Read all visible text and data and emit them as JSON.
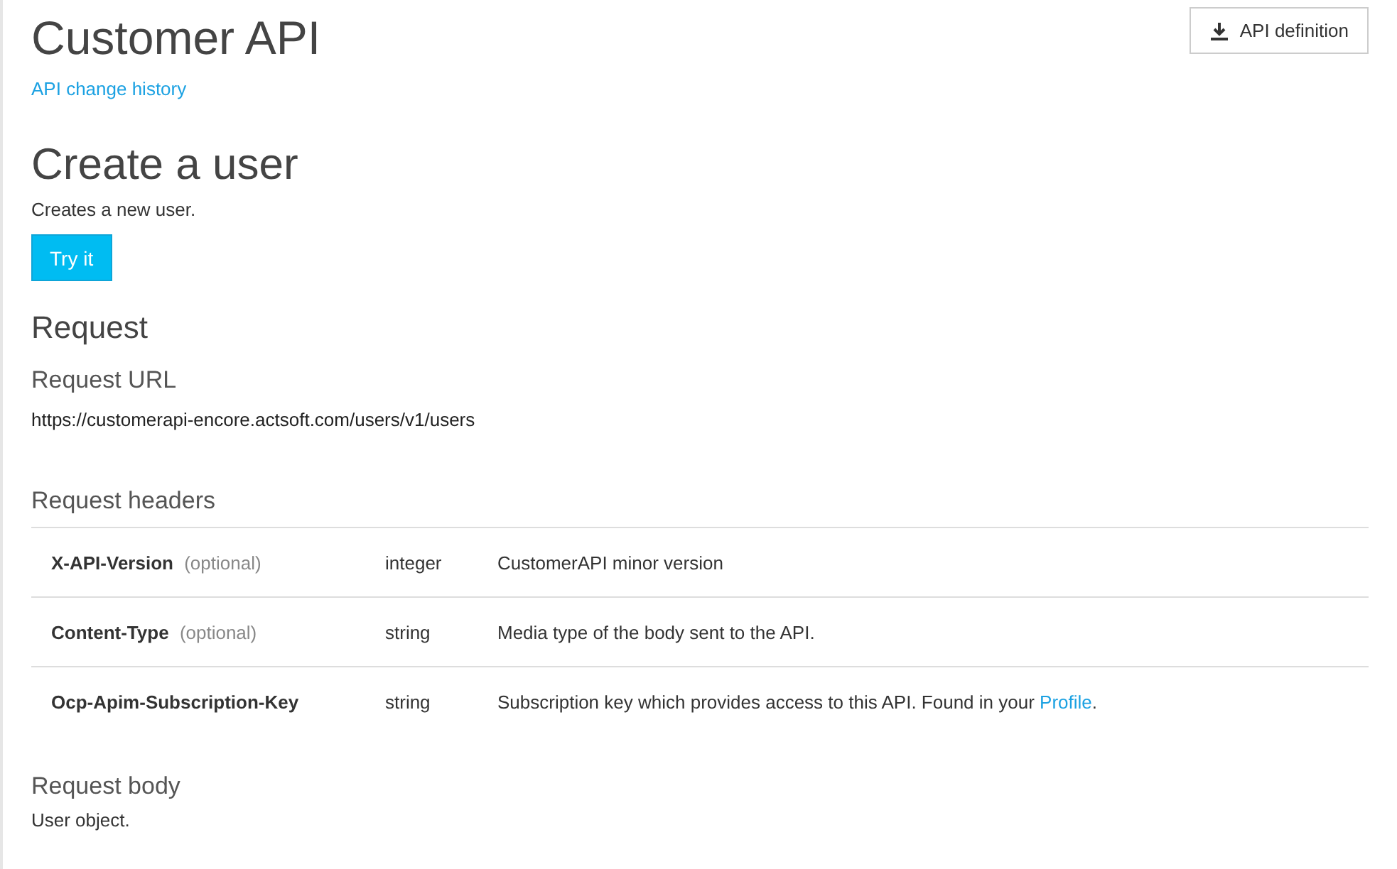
{
  "api_title": "Customer API",
  "definition_button": "API definition",
  "change_history_link": "API change history",
  "operation": {
    "title": "Create a user",
    "description": "Creates a new user.",
    "try_button": "Try it"
  },
  "request": {
    "heading": "Request",
    "url_heading": "Request URL",
    "url": "https://customerapi-encore.actsoft.com/users/v1/users",
    "headers_heading": "Request headers",
    "headers": [
      {
        "name": "X-API-Version",
        "optional_label": "(optional)",
        "type": "integer",
        "description": "CustomerAPI minor version"
      },
      {
        "name": "Content-Type",
        "optional_label": "(optional)",
        "type": "string",
        "description": "Media type of the body sent to the API."
      },
      {
        "name": "Ocp-Apim-Subscription-Key",
        "type": "string",
        "description": "Subscription key which provides access to this API. Found in your ",
        "link": "Profile",
        "description_end": "."
      }
    ],
    "body_heading": "Request body",
    "body_description": "User object."
  }
}
